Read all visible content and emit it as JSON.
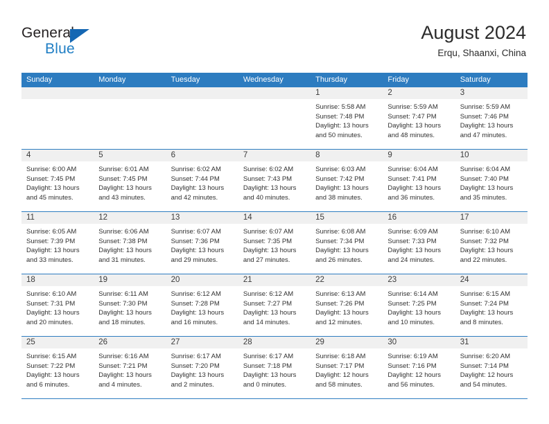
{
  "logo": {
    "word_top": "General",
    "word_bottom": "Blue",
    "triangle_color": "#1567b3",
    "blue_text_color": "#1f7ec4"
  },
  "header": {
    "title": "August 2024",
    "subtitle": "Erqu, Shaanxi, China"
  },
  "theme": {
    "header_blue": "#2d7cc0",
    "day_band_gray": "#f0f0f0",
    "text_color": "#303030"
  },
  "weekdays": [
    "Sunday",
    "Monday",
    "Tuesday",
    "Wednesday",
    "Thursday",
    "Friday",
    "Saturday"
  ],
  "weeks": [
    [
      {
        "empty": true
      },
      {
        "empty": true
      },
      {
        "empty": true
      },
      {
        "empty": true
      },
      {
        "day": "1",
        "sunrise": "Sunrise: 5:58 AM",
        "sunset": "Sunset: 7:48 PM",
        "daylight1": "Daylight: 13 hours",
        "daylight2": "and 50 minutes."
      },
      {
        "day": "2",
        "sunrise": "Sunrise: 5:59 AM",
        "sunset": "Sunset: 7:47 PM",
        "daylight1": "Daylight: 13 hours",
        "daylight2": "and 48 minutes."
      },
      {
        "day": "3",
        "sunrise": "Sunrise: 5:59 AM",
        "sunset": "Sunset: 7:46 PM",
        "daylight1": "Daylight: 13 hours",
        "daylight2": "and 47 minutes."
      }
    ],
    [
      {
        "day": "4",
        "sunrise": "Sunrise: 6:00 AM",
        "sunset": "Sunset: 7:45 PM",
        "daylight1": "Daylight: 13 hours",
        "daylight2": "and 45 minutes."
      },
      {
        "day": "5",
        "sunrise": "Sunrise: 6:01 AM",
        "sunset": "Sunset: 7:45 PM",
        "daylight1": "Daylight: 13 hours",
        "daylight2": "and 43 minutes."
      },
      {
        "day": "6",
        "sunrise": "Sunrise: 6:02 AM",
        "sunset": "Sunset: 7:44 PM",
        "daylight1": "Daylight: 13 hours",
        "daylight2": "and 42 minutes."
      },
      {
        "day": "7",
        "sunrise": "Sunrise: 6:02 AM",
        "sunset": "Sunset: 7:43 PM",
        "daylight1": "Daylight: 13 hours",
        "daylight2": "and 40 minutes."
      },
      {
        "day": "8",
        "sunrise": "Sunrise: 6:03 AM",
        "sunset": "Sunset: 7:42 PM",
        "daylight1": "Daylight: 13 hours",
        "daylight2": "and 38 minutes."
      },
      {
        "day": "9",
        "sunrise": "Sunrise: 6:04 AM",
        "sunset": "Sunset: 7:41 PM",
        "daylight1": "Daylight: 13 hours",
        "daylight2": "and 36 minutes."
      },
      {
        "day": "10",
        "sunrise": "Sunrise: 6:04 AM",
        "sunset": "Sunset: 7:40 PM",
        "daylight1": "Daylight: 13 hours",
        "daylight2": "and 35 minutes."
      }
    ],
    [
      {
        "day": "11",
        "sunrise": "Sunrise: 6:05 AM",
        "sunset": "Sunset: 7:39 PM",
        "daylight1": "Daylight: 13 hours",
        "daylight2": "and 33 minutes."
      },
      {
        "day": "12",
        "sunrise": "Sunrise: 6:06 AM",
        "sunset": "Sunset: 7:38 PM",
        "daylight1": "Daylight: 13 hours",
        "daylight2": "and 31 minutes."
      },
      {
        "day": "13",
        "sunrise": "Sunrise: 6:07 AM",
        "sunset": "Sunset: 7:36 PM",
        "daylight1": "Daylight: 13 hours",
        "daylight2": "and 29 minutes."
      },
      {
        "day": "14",
        "sunrise": "Sunrise: 6:07 AM",
        "sunset": "Sunset: 7:35 PM",
        "daylight1": "Daylight: 13 hours",
        "daylight2": "and 27 minutes."
      },
      {
        "day": "15",
        "sunrise": "Sunrise: 6:08 AM",
        "sunset": "Sunset: 7:34 PM",
        "daylight1": "Daylight: 13 hours",
        "daylight2": "and 26 minutes."
      },
      {
        "day": "16",
        "sunrise": "Sunrise: 6:09 AM",
        "sunset": "Sunset: 7:33 PM",
        "daylight1": "Daylight: 13 hours",
        "daylight2": "and 24 minutes."
      },
      {
        "day": "17",
        "sunrise": "Sunrise: 6:10 AM",
        "sunset": "Sunset: 7:32 PM",
        "daylight1": "Daylight: 13 hours",
        "daylight2": "and 22 minutes."
      }
    ],
    [
      {
        "day": "18",
        "sunrise": "Sunrise: 6:10 AM",
        "sunset": "Sunset: 7:31 PM",
        "daylight1": "Daylight: 13 hours",
        "daylight2": "and 20 minutes."
      },
      {
        "day": "19",
        "sunrise": "Sunrise: 6:11 AM",
        "sunset": "Sunset: 7:30 PM",
        "daylight1": "Daylight: 13 hours",
        "daylight2": "and 18 minutes."
      },
      {
        "day": "20",
        "sunrise": "Sunrise: 6:12 AM",
        "sunset": "Sunset: 7:28 PM",
        "daylight1": "Daylight: 13 hours",
        "daylight2": "and 16 minutes."
      },
      {
        "day": "21",
        "sunrise": "Sunrise: 6:12 AM",
        "sunset": "Sunset: 7:27 PM",
        "daylight1": "Daylight: 13 hours",
        "daylight2": "and 14 minutes."
      },
      {
        "day": "22",
        "sunrise": "Sunrise: 6:13 AM",
        "sunset": "Sunset: 7:26 PM",
        "daylight1": "Daylight: 13 hours",
        "daylight2": "and 12 minutes."
      },
      {
        "day": "23",
        "sunrise": "Sunrise: 6:14 AM",
        "sunset": "Sunset: 7:25 PM",
        "daylight1": "Daylight: 13 hours",
        "daylight2": "and 10 minutes."
      },
      {
        "day": "24",
        "sunrise": "Sunrise: 6:15 AM",
        "sunset": "Sunset: 7:24 PM",
        "daylight1": "Daylight: 13 hours",
        "daylight2": "and 8 minutes."
      }
    ],
    [
      {
        "day": "25",
        "sunrise": "Sunrise: 6:15 AM",
        "sunset": "Sunset: 7:22 PM",
        "daylight1": "Daylight: 13 hours",
        "daylight2": "and 6 minutes."
      },
      {
        "day": "26",
        "sunrise": "Sunrise: 6:16 AM",
        "sunset": "Sunset: 7:21 PM",
        "daylight1": "Daylight: 13 hours",
        "daylight2": "and 4 minutes."
      },
      {
        "day": "27",
        "sunrise": "Sunrise: 6:17 AM",
        "sunset": "Sunset: 7:20 PM",
        "daylight1": "Daylight: 13 hours",
        "daylight2": "and 2 minutes."
      },
      {
        "day": "28",
        "sunrise": "Sunrise: 6:17 AM",
        "sunset": "Sunset: 7:18 PM",
        "daylight1": "Daylight: 13 hours",
        "daylight2": "and 0 minutes."
      },
      {
        "day": "29",
        "sunrise": "Sunrise: 6:18 AM",
        "sunset": "Sunset: 7:17 PM",
        "daylight1": "Daylight: 12 hours",
        "daylight2": "and 58 minutes."
      },
      {
        "day": "30",
        "sunrise": "Sunrise: 6:19 AM",
        "sunset": "Sunset: 7:16 PM",
        "daylight1": "Daylight: 12 hours",
        "daylight2": "and 56 minutes."
      },
      {
        "day": "31",
        "sunrise": "Sunrise: 6:20 AM",
        "sunset": "Sunset: 7:14 PM",
        "daylight1": "Daylight: 12 hours",
        "daylight2": "and 54 minutes."
      }
    ]
  ]
}
